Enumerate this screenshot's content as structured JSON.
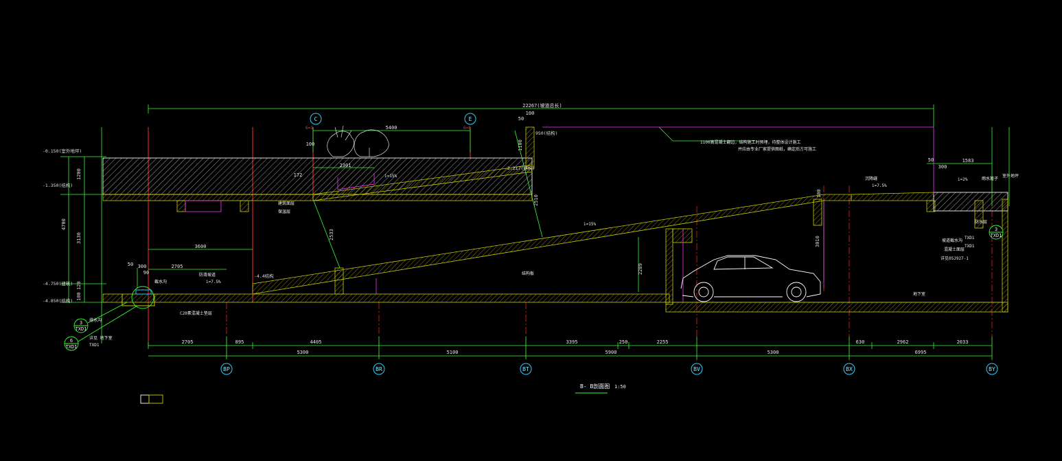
{
  "drawing": {
    "title": "B- B剖面图",
    "scale": "1:50",
    "overall_dim": "22267(坡道总长)"
  },
  "axes": {
    "bottom": [
      "BP",
      "BR",
      "BT",
      "BV",
      "BX",
      "BY"
    ],
    "top": [
      "C",
      "E"
    ]
  },
  "levels": {
    "l1": "-0.150(室外地坪)",
    "l2": "-1.350(结构)",
    "l3": "-4.750(建筑)",
    "l4": "-4.850(结构)",
    "top_right": "950(结构)",
    "mid_left": "-2.217(结构)",
    "ramp_bottom": "-4.4结构"
  },
  "dims": {
    "bottom_row1": [
      "2705",
      "895",
      "4405",
      "3395",
      "250",
      "2255",
      "630",
      "2962",
      "2033"
    ],
    "bottom_row2": [
      "5300",
      "5100",
      "5900",
      "5300",
      "6995"
    ],
    "top_span": "5400",
    "left_vertical": [
      "1200",
      "3130",
      "4700",
      "120",
      "100"
    ],
    "misc": [
      "2301",
      "2533",
      "2510",
      "2289",
      "3010",
      "3600",
      "2705",
      "50",
      "300",
      "90",
      "1100",
      "50",
      "100",
      "1583",
      "300",
      "50",
      "172",
      "100",
      "100"
    ],
    "slopes": [
      "i=15%",
      "i=15%",
      "i=7.5%",
      "i=7.5%",
      "i=2%"
    ]
  },
  "notes": {
    "n1": "1100高混凝土翻边，结构施工时预埋，待整体设计施工",
    "n2": "并应由专业厂家提供图纸，确定后方可施工",
    "n3": "C20素混凝土垫层",
    "n4": "截水沟",
    "n5": "防滑坡道",
    "n6": "排水沟",
    "n7": "详见 地下室",
    "n8": "建筑面层",
    "n9": "保温层",
    "n10": "结构板",
    "n11": "沉降缝",
    "n12": "防水层",
    "n13": "坡道截水沟",
    "n14": "TXD1",
    "n15": "TXD1",
    "n16": "TXD1",
    "n17": "混凝土面层",
    "n18": "详见05J927-1",
    "n19": "雨水篦子",
    "n20": "地下室",
    "n21": "室外地坪"
  },
  "callouts": [
    {
      "num": "3",
      "sheet": "TXD1"
    },
    {
      "num": "6",
      "sheet": "TXD1"
    },
    {
      "num": "3",
      "sheet": "TXD1"
    }
  ],
  "markers": [
    "6=3",
    "6=8"
  ]
}
